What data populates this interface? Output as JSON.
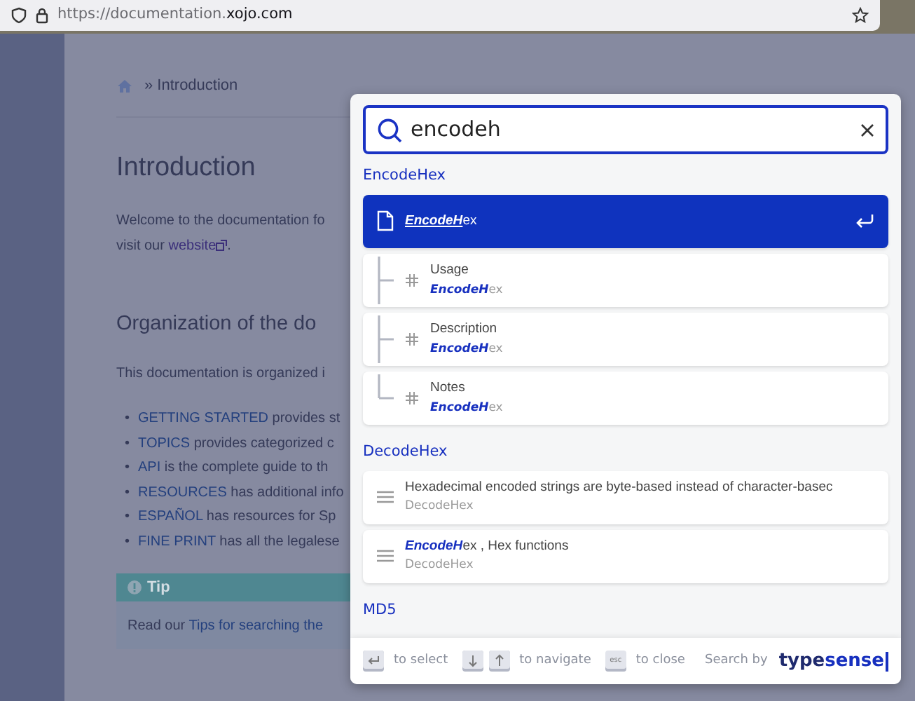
{
  "browser": {
    "url_parts": [
      "https://documentation.",
      "xojo.com"
    ]
  },
  "page": {
    "breadcrumb": "» Introduction",
    "title": "Introduction",
    "intro_lines": [
      {
        "before": "Welcome to the documentation fo"
      },
      {
        "before": "visit our ",
        "link": "website",
        "after": "."
      }
    ],
    "section_title": "Organization of the do",
    "section_text": "This documentation is organized i",
    "bullets": [
      {
        "marker": "•",
        "link": "GETTING STARTED",
        "text": " provides st"
      },
      {
        "marker": "•",
        "link": "TOPICS",
        "text": " provides categorized c"
      },
      {
        "marker": "•",
        "link": "API",
        "text": " is the complete guide to th"
      },
      {
        "marker": "•",
        "link": "RESOURCES",
        "text": " has additional info"
      },
      {
        "marker": "•",
        "link": "ESPAÑOL",
        "text": " has resources for Sp"
      },
      {
        "marker": "•",
        "link": "FINE PRINT",
        "text": " has all the legalese"
      }
    ],
    "tip": {
      "title": "Tip",
      "text": "Read our ",
      "link": "Tips for searching the"
    }
  },
  "search": {
    "query": "encodeh",
    "groups": [
      {
        "title": "EncodeHex",
        "hits": [
          {
            "kind": "page",
            "title": "**EncodeH**ex",
            "selected": true
          },
          {
            "kind": "heading",
            "title": "Usage",
            "path": "**EncodeH**ex",
            "selected": false
          },
          {
            "kind": "heading",
            "title": "Description",
            "path": "**EncodeH**ex",
            "selected": false
          },
          {
            "kind": "heading",
            "title": "Notes",
            "path": "**EncodeH**ex",
            "selected": false
          }
        ]
      },
      {
        "title": "DecodeHex",
        "hits": [
          {
            "kind": "content",
            "title": "Hexadecimal encoded strings are byte-based instead of character-basec",
            "path": "DecodeHex",
            "selected": false
          },
          {
            "kind": "content",
            "title": "**EncodeH**ex , Hex functions",
            "path": "DecodeHex",
            "selected": false
          }
        ]
      },
      {
        "title": "MD5"
      }
    ],
    "footer": {
      "hints": [
        {
          "keys": [
            {
              "kind": "enter"
            }
          ],
          "label": "to select"
        },
        {
          "keys": [
            {
              "kind": "down"
            },
            {
              "kind": "up"
            }
          ],
          "label": "to navigate"
        },
        {
          "keys": [
            {
              "kind": "text",
              "text": "esc"
            }
          ],
          "label": "to close"
        }
      ],
      "search_by": "Search by",
      "logo_parts": [
        "type",
        "sense"
      ]
    }
  }
}
